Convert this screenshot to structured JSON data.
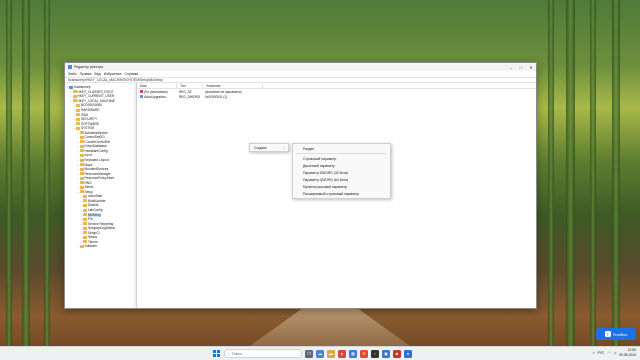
{
  "window": {
    "title": "Редактор реестра",
    "menu": [
      "Файл",
      "Правка",
      "Вид",
      "Избранное",
      "Справка"
    ],
    "address": "Компьютер\\HKEY_LOCAL_MACHINE\\SYSTEM\\Setup\\MoSetup",
    "controls": {
      "minimize": "–",
      "maximize": "□",
      "close": "✕"
    }
  },
  "tree": {
    "items": [
      {
        "label": "Компьютер",
        "level": 0,
        "arrow": "⌄"
      },
      {
        "label": "HKEY_CLASSES_ROOT",
        "level": 1,
        "arrow": "›"
      },
      {
        "label": "HKEY_CURRENT_USER",
        "level": 1,
        "arrow": "›"
      },
      {
        "label": "HKEY_LOCAL_MACHINE",
        "level": 1,
        "arrow": "⌄"
      },
      {
        "label": "BCD00000000",
        "level": 2,
        "arrow": "›"
      },
      {
        "label": "HARDWARE",
        "level": 2,
        "arrow": "›"
      },
      {
        "label": "SAM",
        "level": 2,
        "arrow": "›"
      },
      {
        "label": "SECURITY",
        "level": 2,
        "arrow": "›"
      },
      {
        "label": "SOFTWARE",
        "level": 2,
        "arrow": "›"
      },
      {
        "label": "SYSTEM",
        "level": 2,
        "arrow": "⌄"
      },
      {
        "label": "ActivationBroker",
        "level": 3,
        "arrow": "›"
      },
      {
        "label": "ControlSet001",
        "level": 3,
        "arrow": "›"
      },
      {
        "label": "CurrentControlSet",
        "level": 3,
        "arrow": "›"
      },
      {
        "label": "DriverDatabase",
        "level": 3,
        "arrow": "›"
      },
      {
        "label": "HardwareConfig",
        "level": 3,
        "arrow": "›"
      },
      {
        "label": "Input",
        "level": 3,
        "arrow": "›"
      },
      {
        "label": "Keyboard Layout",
        "level": 3,
        "arrow": "›"
      },
      {
        "label": "Maps",
        "level": 3,
        "arrow": "›"
      },
      {
        "label": "MountedDevices",
        "level": 3,
        "arrow": "›"
      },
      {
        "label": "ResourceManager",
        "level": 3,
        "arrow": "›"
      },
      {
        "label": "ResourcePolicyStore",
        "level": 3,
        "arrow": "›"
      },
      {
        "label": "RNG",
        "level": 3,
        "arrow": "›"
      },
      {
        "label": "Select",
        "level": 3,
        "arrow": "›"
      },
      {
        "label": "Setup",
        "level": 3,
        "arrow": "⌄"
      },
      {
        "label": "AllowStart",
        "level": 4,
        "arrow": "›"
      },
      {
        "label": "BuildUpdate",
        "level": 4,
        "arrow": "›"
      },
      {
        "label": "DiskIds",
        "level": 4,
        "arrow": "›"
      },
      {
        "label": "LabConfig",
        "level": 4,
        "arrow": "›"
      },
      {
        "label": "MoSetup",
        "level": 4,
        "arrow": "›",
        "selected": true
      },
      {
        "label": "Pid",
        "level": 4,
        "arrow": "›"
      },
      {
        "label": "Service Reporting",
        "level": 4,
        "arrow": "›"
      },
      {
        "label": "SetupapiLogStatus",
        "level": 4,
        "arrow": "›"
      },
      {
        "label": "SetupCI",
        "level": 4,
        "arrow": "›"
      },
      {
        "label": "Status",
        "level": 4,
        "arrow": "›"
      },
      {
        "label": "Timers",
        "level": 4,
        "arrow": "›"
      },
      {
        "label": "Software",
        "level": 3,
        "arrow": "›"
      }
    ]
  },
  "list": {
    "headers": [
      "Имя",
      "Тип",
      "Значение"
    ],
    "rows": [
      {
        "name": "(По умолчанию)",
        "type": "REG_SZ",
        "value": "(значение не присвоено)"
      },
      {
        "name": "AllowUpgrades...",
        "type": "REG_DWORD",
        "value": "0x00000001 (1)"
      }
    ]
  },
  "context_menu": {
    "create_label": "Создать",
    "submenu": [
      "Раздел",
      "Строковый параметр",
      "Двоичный параметр",
      "Параметр DWORD (32 бита)",
      "Параметр QWORD (64 бита)",
      "Мультистроковый параметр",
      "Расширяемый строковый параметр"
    ]
  },
  "terabox": {
    "label": "TeraBox",
    "icon": "T"
  },
  "taskbar": {
    "search_placeholder": "Поиск",
    "apps": [
      {
        "name": "task-view",
        "glyph": "❐",
        "color": "#5b6775"
      },
      {
        "name": "widgets",
        "glyph": "☁",
        "color": "#4a88c7"
      },
      {
        "name": "explorer",
        "glyph": "▬",
        "color": "#e2a93a"
      },
      {
        "name": "chrome",
        "glyph": "●",
        "color": "#d9473a"
      },
      {
        "name": "store",
        "glyph": "▦",
        "color": "#3d7ad6"
      },
      {
        "name": "yandex",
        "glyph": "Я",
        "color": "#e24a2d"
      },
      {
        "name": "terminal",
        "glyph": "›",
        "color": "#333"
      },
      {
        "name": "regedit",
        "glyph": "▣",
        "color": "#3a78c2"
      },
      {
        "name": "app-red",
        "glyph": "■",
        "color": "#c0392b"
      },
      {
        "name": "app-blue",
        "glyph": "●",
        "color": "#2f6fd6"
      }
    ],
    "time": "12:50",
    "date": "09.08.2024"
  }
}
